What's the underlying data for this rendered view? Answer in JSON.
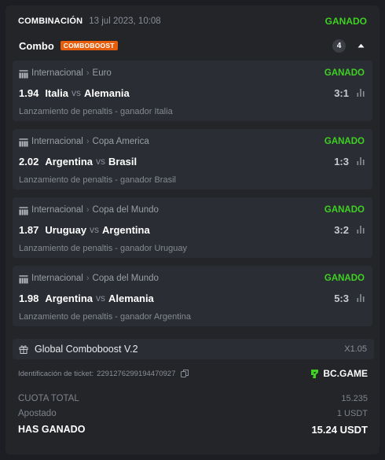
{
  "header": {
    "type": "COMBINACIÓN",
    "date": "13 jul 2023, 10:08",
    "status": "GANADO"
  },
  "combo": {
    "title": "Combo",
    "badge": "COMBOBOOST",
    "count": "4"
  },
  "colors": {
    "won": "#3fd122",
    "badge": "#e85d0c",
    "background": "#232529",
    "card": "#2a2d33"
  },
  "icons": [
    "efootball-fifa-logo-icon",
    "stats-bars-icon",
    "chevron-up-icon",
    "gift-icon",
    "copy-icon",
    "bcgame-logo-icon"
  ],
  "bets": [
    {
      "league": "Internacional",
      "tournament": "Euro",
      "status": "GANADO",
      "odds": "1.94",
      "home": "Italia",
      "vs": "vs",
      "away": "Alemania",
      "score": "3:1",
      "selection": "Lanzamiento de penaltis - ganador Italia"
    },
    {
      "league": "Internacional",
      "tournament": "Copa America",
      "status": "GANADO",
      "odds": "2.02",
      "home": "Argentina",
      "vs": "vs",
      "away": "Brasil",
      "score": "1:3",
      "selection": "Lanzamiento de penaltis - ganador Brasil"
    },
    {
      "league": "Internacional",
      "tournament": "Copa del Mundo",
      "status": "GANADO",
      "odds": "1.87",
      "home": "Uruguay",
      "vs": "vs",
      "away": "Argentina",
      "score": "3:2",
      "selection": "Lanzamiento de penaltis - ganador Uruguay"
    },
    {
      "league": "Internacional",
      "tournament": "Copa del Mundo",
      "status": "GANADO",
      "odds": "1.98",
      "home": "Argentina",
      "vs": "vs",
      "away": "Alemania",
      "score": "5:3",
      "selection": "Lanzamiento de penaltis - ganador Argentina"
    }
  ],
  "boost": {
    "name": "Global Comboboost V.2",
    "multiplier": "X1.05"
  },
  "ticket": {
    "label": "Identificación de ticket:",
    "id": "2291276299194470927",
    "brand": "BC.GAME"
  },
  "summary": {
    "total_odds_label": "CUOTA TOTAL",
    "total_odds": "15.235",
    "staked_label": "Apostado",
    "staked": "1 USDT",
    "won_label": "HAS GANADO",
    "won": "15.24 USDT"
  }
}
